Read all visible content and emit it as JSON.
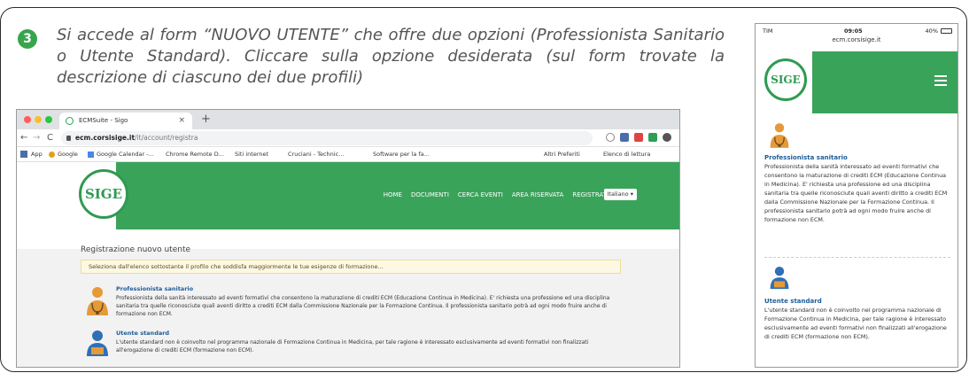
{
  "step": {
    "number": "3"
  },
  "instruction": "Si accede al form “NUOVO UTENTE” che offre due opzioni (Professionista Sanitario o Utente Standard). Cliccare sulla opzione desiderata (sul form trovate la descrizione di ciascuno dei due profili)",
  "desktop": {
    "tab_title": "ECMSuite - Sigo",
    "tab_close": "×",
    "new_tab": "+",
    "url_host": "ecm.corsisige.it",
    "url_path": "/it/account/registra",
    "bookmarks": [
      "App",
      "Google",
      "Google Calendar -...",
      "Chrome Remote D...",
      "Siti internet",
      "Cruciani - Technic...",
      "Software per la fa...",
      "Altri Preferiti",
      "Elenco di lettura"
    ],
    "menu": [
      "HOME",
      "DOCUMENTI",
      "CERCA EVENTI",
      "AREA RISERVATA",
      "REGISTRATI"
    ],
    "language": "Italiano ▾",
    "logo_text": "SIGE",
    "page_title": "Registrazione nuovo utente",
    "notice": "Seleziona dall'elenco sottostante il profilo che soddisfa maggiormente le tue esigenze di formazione...",
    "roles": [
      {
        "title": "Professionista sanitario",
        "description": "Professionista della sanità interessato ad eventi formativi che consentono la maturazione di crediti ECM (Educazione Continua in Medicina). E' richiesta una professione ed una disciplina sanitaria tra quelle riconosciute quali aventi diritto a crediti ECM dalla Commissione Nazionale per la Formazione Continua. Il professionista sanitario potrà ad ogni modo fruire anche di formazione non ECM."
      },
      {
        "title": "Utente standard",
        "description": "L'utente standard non è coinvolto nel programma nazionale di Formazione Continua in Medicina, per tale ragione è interessato esclusivamente ad eventi formativi non finalizzati all'erogazione di crediti ECM (formazione non ECM)."
      }
    ]
  },
  "mobile": {
    "carrier": "TIM",
    "time": "09:05",
    "battery": "40%",
    "url": "ecm.corsisige.it",
    "logo_text": "SIGE",
    "roles": [
      {
        "title": "Professionista sanitario",
        "description": "Professionista della sanità interessato ad eventi formativi che consentono la maturazione di crediti ECM (Educazione Continua in Medicina). E' richiesta una professione ed una disciplina sanitaria tra quelle riconosciute quali aventi diritto a crediti ECM dalla Commissione Nazionale per la Formazione Continua. Il professionista sanitario potrà ad ogni modo fruire anche di formazione non ECM."
      },
      {
        "title": "Utente standard",
        "description": "L'utente standard non è coinvolto nel programma nazionale di Formazione Continua in Medicina, per tale ragione è interessato esclusivamente ad eventi formativi non finalizzati all'erogazione di crediti ECM (formazione non ECM)."
      }
    ]
  },
  "colors": {
    "brand_green": "#3aa35a",
    "badge_green": "#37a54b",
    "link_blue": "#1d5c99",
    "notice_bg": "#fcf8e3"
  }
}
